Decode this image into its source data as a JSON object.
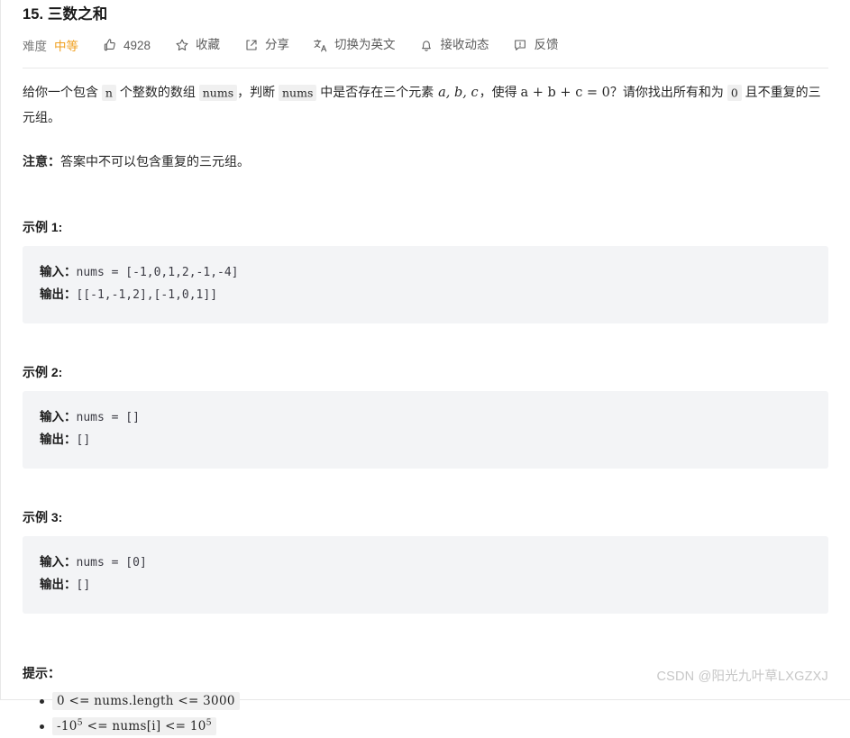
{
  "problem": {
    "title": "15. 三数之和"
  },
  "toolbar": {
    "difficulty_label": "难度",
    "difficulty_value": "中等",
    "difficulty_color": "#f0a020",
    "like_icon": "thumbs-up-icon",
    "like_count": "4928",
    "favorite_icon": "star-icon",
    "favorite_label": "收藏",
    "share_icon": "share-icon",
    "share_label": "分享",
    "translate_icon": "translate-icon",
    "translate_label": "切换为英文",
    "subscribe_icon": "bell-icon",
    "subscribe_label": "接收动态",
    "feedback_icon": "feedback-icon",
    "feedback_label": "反馈"
  },
  "description": {
    "p1_seg1": "给你一个包含",
    "p1_code1": "n",
    "p1_seg2": "个整数的数组",
    "p1_code2": "nums",
    "p1_seg3": "，判断",
    "p1_code3": "nums",
    "p1_seg4": "中是否存在三个元素",
    "p1_math1": "a, b, c",
    "p1_seg5": "，使得",
    "p1_math2": "a + b + c = 0",
    "p1_seg6": "？请你找出所有和为",
    "p1_code4": "0",
    "p1_seg7": "且不重复的三元组。",
    "note_strong": "注意：",
    "note_text": "答案中不可以包含重复的三元组。"
  },
  "examples": [
    {
      "heading": "示例 1:",
      "input_label": "输入：",
      "input_value": "nums = [-1,0,1,2,-1,-4]",
      "output_label": "输出：",
      "output_value": "[[-1,-1,2],[-1,0,1]]"
    },
    {
      "heading": "示例 2:",
      "input_label": "输入：",
      "input_value": "nums = []",
      "output_label": "输出：",
      "output_value": "[]"
    },
    {
      "heading": "示例 3:",
      "input_label": "输入：",
      "input_value": "nums = [0]",
      "output_label": "输出：",
      "output_value": "[]"
    }
  ],
  "hints": {
    "heading": "提示：",
    "items": [
      {
        "pre": "0 <= nums.length <= 3000"
      },
      {
        "pre_a": "-10",
        "sup_a": "5",
        "mid": " <= nums[i] <= 10",
        "sup_b": "5"
      }
    ]
  },
  "watermark": {
    "text": "CSDN @阳光九叶草LXGZXJ"
  }
}
